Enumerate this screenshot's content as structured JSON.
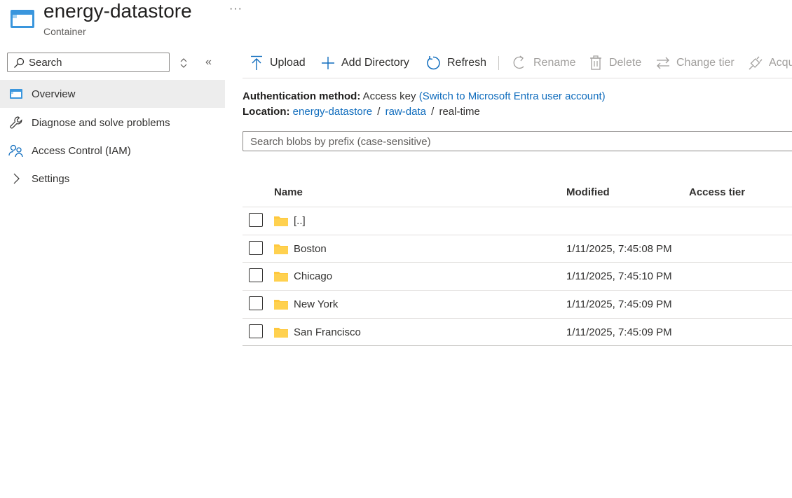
{
  "header": {
    "title": "energy-datastore",
    "subtitle": "Container",
    "more_label": "···"
  },
  "sidebar": {
    "search_placeholder": "Search",
    "expand_icon": "up-down-icon",
    "collapse_label": "«",
    "items": [
      {
        "label": "Overview",
        "icon": "container-icon",
        "active": true
      },
      {
        "label": "Diagnose and solve problems",
        "icon": "wrench-icon"
      },
      {
        "label": "Access Control (IAM)",
        "icon": "people-icon"
      },
      {
        "label": "Settings",
        "icon": "chevron-right-icon"
      }
    ]
  },
  "toolbar": {
    "upload": "Upload",
    "add_directory": "Add Directory",
    "refresh": "Refresh",
    "rename": "Rename",
    "delete": "Delete",
    "change_tier": "Change tier",
    "acquire": "Acqu"
  },
  "info": {
    "auth_label": "Authentication method:",
    "auth_value": "Access key",
    "auth_link": "(Switch to Microsoft Entra user account)",
    "location_label": "Location:",
    "crumbs": [
      "energy-datastore",
      "raw-data",
      "real-time"
    ],
    "sep": "/"
  },
  "blob_search": {
    "placeholder": "Search blobs by prefix (case-sensitive)"
  },
  "table": {
    "headers": {
      "name": "Name",
      "modified": "Modified",
      "tier": "Access tier"
    },
    "rows": [
      {
        "name": "[..]",
        "modified": "",
        "tier": ""
      },
      {
        "name": "Boston",
        "modified": "1/11/2025, 7:45:08 PM",
        "tier": ""
      },
      {
        "name": "Chicago",
        "modified": "1/11/2025, 7:45:10 PM",
        "tier": ""
      },
      {
        "name": "New York",
        "modified": "1/11/2025, 7:45:09 PM",
        "tier": ""
      },
      {
        "name": "San Francisco",
        "modified": "1/11/2025, 7:45:09 PM",
        "tier": ""
      }
    ]
  },
  "colors": {
    "accent": "#0f6cbd",
    "folder": "#ffc83d",
    "container_icon": "#3a96dd"
  }
}
